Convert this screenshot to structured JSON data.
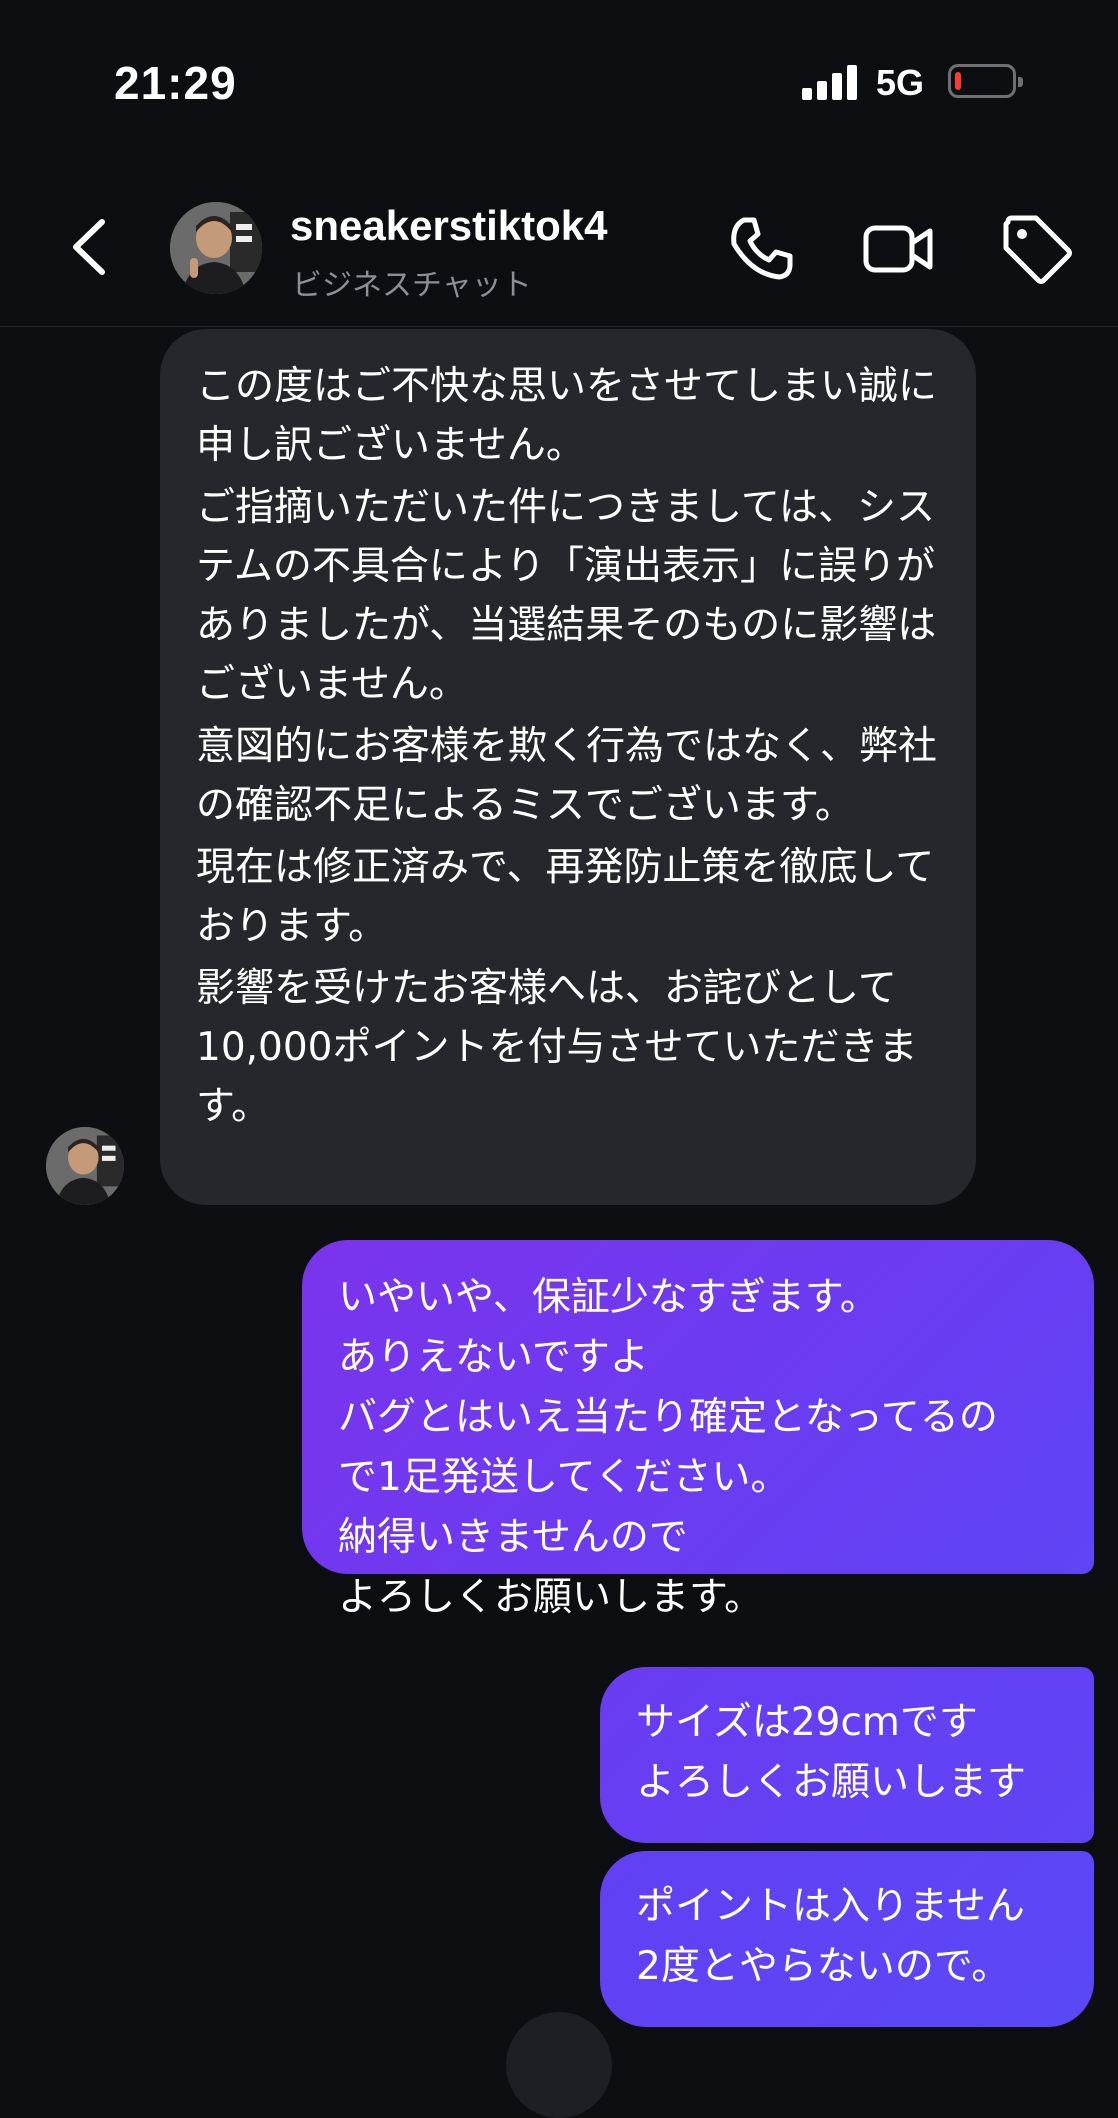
{
  "status_bar": {
    "time": "21:29",
    "network": "5G",
    "battery_level": 0.1,
    "battery_color": "#ff3b30"
  },
  "header": {
    "contact_name": "sneakerstiktok4",
    "contact_subtitle": "ビジネスチャット",
    "icons": [
      "chevron-left-icon",
      "phone-icon",
      "video-camera-icon",
      "tag-icon"
    ]
  },
  "messages": {
    "incoming": {
      "paragraphs": [
        "この度はご不快な思いをさせてしまい誠に申し訳ございません。",
        "ご指摘いただいた件につきましては、システムの不具合により「演出表示」に誤りがありましたが、当選結果そのものに影響はございません。",
        "意図的にお客様を欺く行為ではなく、弊社の確認不足によるミスでございます。",
        "現在は修正済みで、再発防止策を徹底しております。",
        "影響を受けたお客様へは、お詫びとして10,000ポイントを付与させていただきます。"
      ]
    },
    "outgoing": [
      {
        "lines": [
          "いやいや、保証少なすぎます。",
          "ありえないですよ",
          "バグとはいえ当たり確定となってるの",
          "で1足発送してください。",
          "納得いきませんので",
          "よろしくお願いします。"
        ]
      },
      {
        "lines": [
          "サイズは29cmです",
          "よろしくお願いします"
        ]
      },
      {
        "lines": [
          "ポイントは入りません",
          "2度とやらないので。"
        ]
      }
    ],
    "colors": {
      "incoming_bubble": "#25272c",
      "outgoing_bubble": "#7a34ec",
      "background": "#0c0e12"
    }
  }
}
